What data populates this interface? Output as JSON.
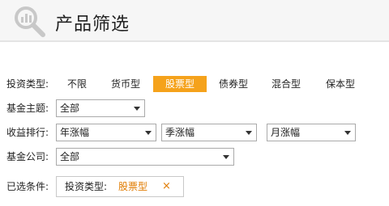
{
  "header": {
    "title": "产品筛选",
    "icon": "search-chart-icon"
  },
  "filters": {
    "type": {
      "label": "投资类型:",
      "options": [
        "不限",
        "货币型",
        "股票型",
        "债券型",
        "混合型",
        "保本型"
      ],
      "selected": "股票型"
    },
    "theme": {
      "label": "基金主题:",
      "value": "全部"
    },
    "returns": {
      "label": "收益排行:",
      "values": [
        "年涨幅",
        "季涨幅",
        "月涨幅"
      ]
    },
    "company": {
      "label": "基金公司:",
      "value": "全部"
    },
    "chosen": {
      "label": "已选条件:",
      "key": "投资类型:",
      "value": "股票型",
      "remove": "×"
    }
  },
  "colors": {
    "accent": "#f5a21b",
    "accent_text": "#e07b00",
    "header_bg": "#f6f6f6"
  }
}
